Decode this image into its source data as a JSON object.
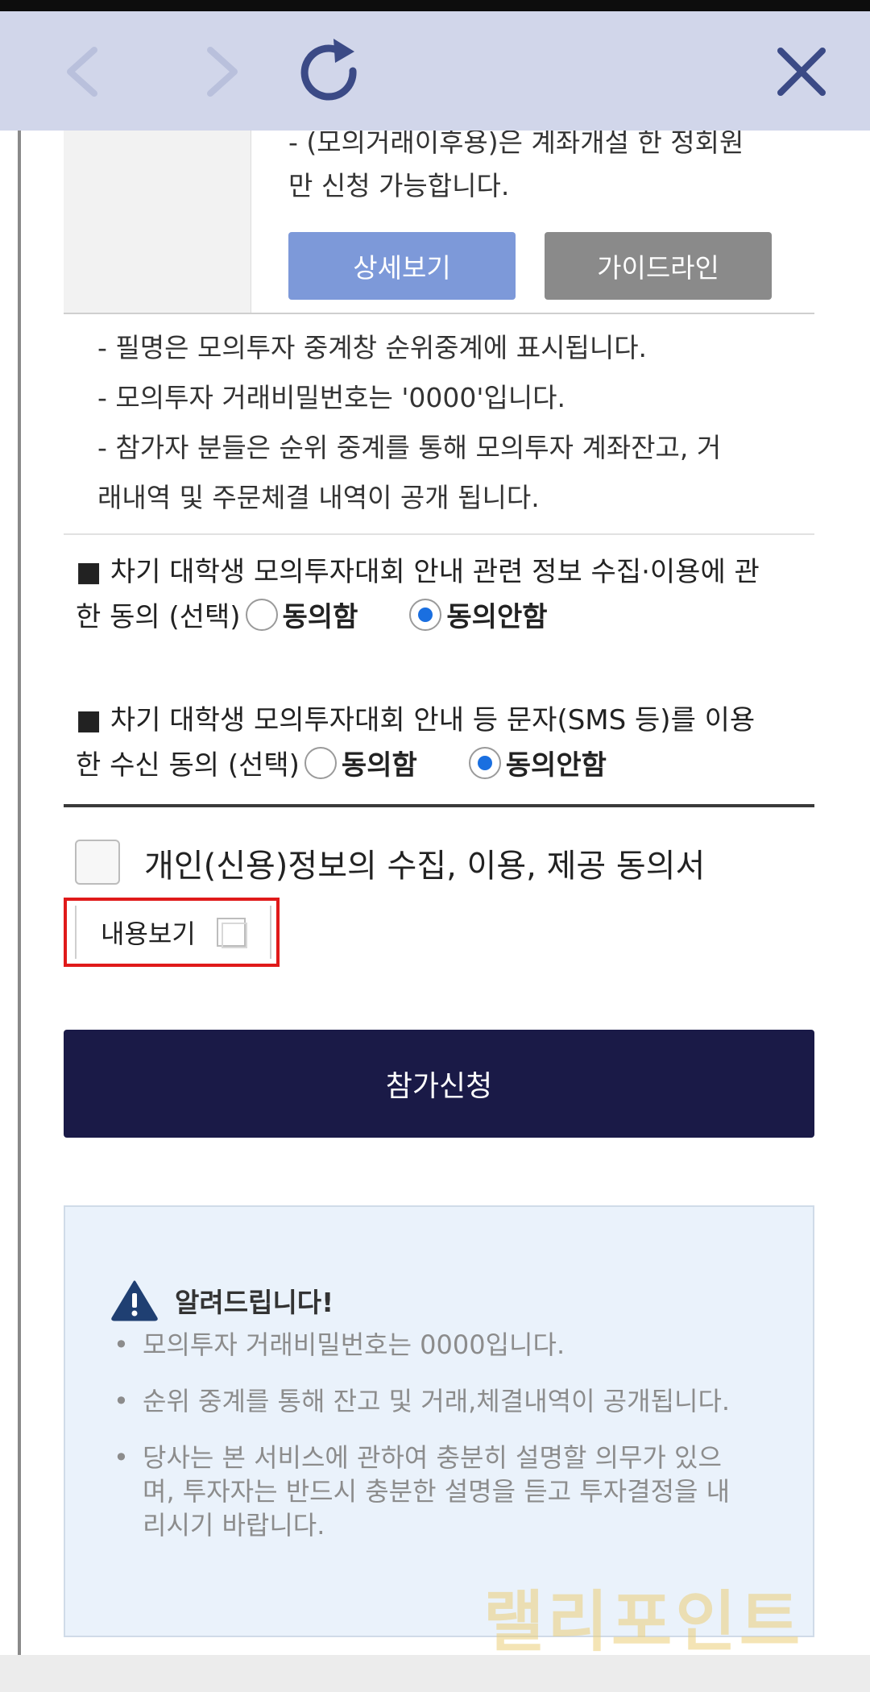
{
  "nav": {
    "back_icon": "chevron-left-icon",
    "forward_icon": "chevron-right-icon",
    "refresh_icon": "refresh-icon",
    "close_icon": "close-icon"
  },
  "account_row": {
    "cut_line": "- (모의거래이후용)은 계좌개설 한 정회원",
    "line2": "만 신청 가능합니다.",
    "detail_button": "상세보기",
    "guide_button": "가이드라인"
  },
  "notes": [
    "- 필명은 모의투자 중계창 순위중계에 표시됩니다.",
    "- 모의투자 거래비밀번호는 '0000'입니다.",
    "- 참가자 분들은 순위 중계를 통해 모의투자 계좌잔고, 거",
    "래내역 및 주문체결 내역이 공개 됩니다."
  ],
  "consent_info": {
    "line1": "■ 차기 대학생 모의투자대회 안내 관련 정보 수집·이용에 관",
    "line2": "한 동의 (선택)",
    "agree": "동의함",
    "disagree": "동의안함",
    "selected": "동의안함"
  },
  "consent_sms": {
    "line1": "■ 차기 대학생 모의투자대회 안내 등 문자(SMS 등)를 이용",
    "line2": "한 수신 동의 (선택)",
    "agree": "동의함",
    "disagree": "동의안함",
    "selected": "동의안함"
  },
  "privacy": {
    "label": "개인(신용)정보의 수집, 이용, 제공 동의서",
    "checked": false,
    "view_label": "내용보기"
  },
  "submit_label": "참가신청",
  "notice": {
    "title": "알려드립니다!",
    "items": [
      [
        "모의투자 거래비밀번호는 0000입니다."
      ],
      [
        "순위 중계를 통해 잔고 및 거래,체결내역이 공개됩니다."
      ],
      [
        "당사는 본 서비스에 관하여 충분히 설명할 의무가 있으",
        "며, 투자자는 반드시 충분한 설명을 듣고 투자결정을 내",
        "리시기 바랍니다."
      ]
    ]
  },
  "watermark": "랠리포인트",
  "colors": {
    "nav_bg": "#d1d6ea",
    "nav_icon": "#3b4a86",
    "submit_bg": "#1a1a47",
    "detail_btn": "#7d99d9",
    "guide_btn": "#8a8a8a",
    "radio_selected": "#1a6fe0",
    "highlight_border": "#e01a1a",
    "notice_bg": "#eaf2fb"
  }
}
